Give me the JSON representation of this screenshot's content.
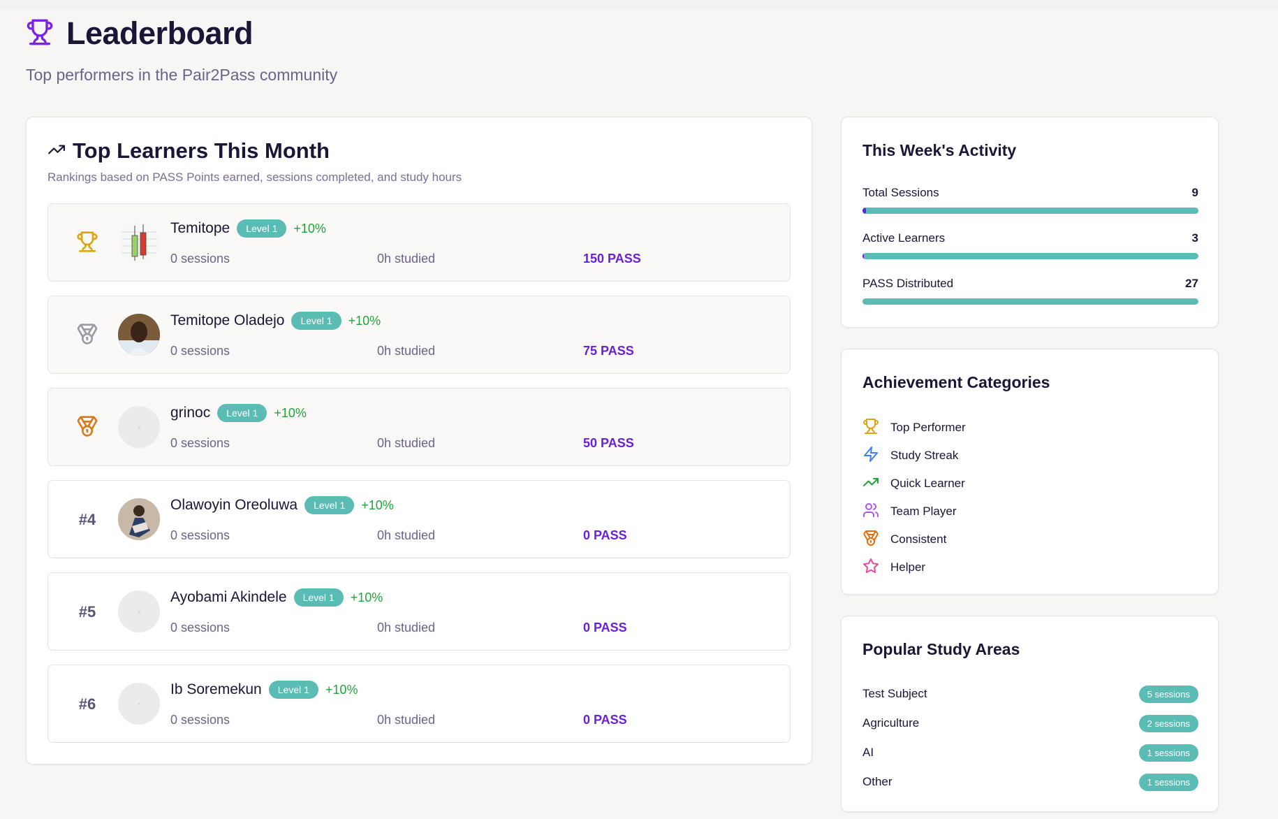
{
  "header": {
    "title": "Leaderboard",
    "subtitle": "Top performers in the Pair2Pass community",
    "icon": "trophy-icon"
  },
  "main": {
    "title": "Top Learners This Month",
    "description": "Rankings based on PASS Points earned, sessions completed, and study hours",
    "icon": "trending-up-icon",
    "learners": [
      {
        "rank": "1",
        "rank_icon": "trophy-icon",
        "name": "Temitope",
        "level": "Level 1",
        "growth": "+10%",
        "sessions": "0 sessions",
        "studied": "0h studied",
        "pass": "150 PASS",
        "avatar": "chart-avatar"
      },
      {
        "rank": "2",
        "rank_icon": "silver-medal-icon",
        "name": "Temitope Oladejo",
        "level": "Level 1",
        "growth": "+10%",
        "sessions": "0 sessions",
        "studied": "0h studied",
        "pass": "75 PASS",
        "avatar": "photo-avatar"
      },
      {
        "rank": "3",
        "rank_icon": "bronze-medal-icon",
        "name": "grinoc",
        "level": "Level 1",
        "growth": "+10%",
        "sessions": "0 sessions",
        "studied": "0h studied",
        "pass": "50 PASS",
        "avatar": "placeholder-avatar"
      },
      {
        "rank": "#4",
        "name": "Olawoyin Oreoluwa",
        "level": "Level 1",
        "growth": "+10%",
        "sessions": "0 sessions",
        "studied": "0h studied",
        "pass": "0 PASS",
        "avatar": "photo-avatar"
      },
      {
        "rank": "#5",
        "name": "Ayobami Akindele",
        "level": "Level 1",
        "growth": "+10%",
        "sessions": "0 sessions",
        "studied": "0h studied",
        "pass": "0 PASS",
        "avatar": "placeholder-avatar"
      },
      {
        "rank": "#6",
        "name": "Ib Soremekun",
        "level": "Level 1",
        "growth": "+10%",
        "sessions": "0 sessions",
        "studied": "0h studied",
        "pass": "0 PASS",
        "avatar": "placeholder-avatar"
      }
    ]
  },
  "activity": {
    "title": "This Week's Activity",
    "items": [
      {
        "label": "Total Sessions",
        "value": "9",
        "fill_fraction": 0.01
      },
      {
        "label": "Active Learners",
        "value": "3",
        "fill_fraction": 0.005
      },
      {
        "label": "PASS Distributed",
        "value": "27",
        "fill_fraction": 0.0
      }
    ]
  },
  "categories": {
    "title": "Achievement Categories",
    "items": [
      {
        "label": "Top Performer",
        "icon": "trophy-icon",
        "color": "#e0a40f"
      },
      {
        "label": "Study Streak",
        "icon": "lightning-icon",
        "color": "#3b82f6"
      },
      {
        "label": "Quick Learner",
        "icon": "trending-up-icon",
        "color": "#22a33a"
      },
      {
        "label": "Team Player",
        "icon": "users-icon",
        "color": "#a855f7"
      },
      {
        "label": "Consistent",
        "icon": "medal-icon",
        "color": "#ea6a0c"
      },
      {
        "label": "Helper",
        "icon": "star-icon",
        "color": "#ec4899"
      }
    ]
  },
  "areas": {
    "title": "Popular Study Areas",
    "items": [
      {
        "label": "Test Subject",
        "badge": "5 sessions"
      },
      {
        "label": "Agriculture",
        "badge": "2 sessions"
      },
      {
        "label": "AI",
        "badge": "1 sessions"
      },
      {
        "label": "Other",
        "badge": "1 sessions"
      }
    ]
  },
  "colors": {
    "accent": "#6a1fd6",
    "teal": "#5bbcb5",
    "growth": "#22a33a"
  }
}
